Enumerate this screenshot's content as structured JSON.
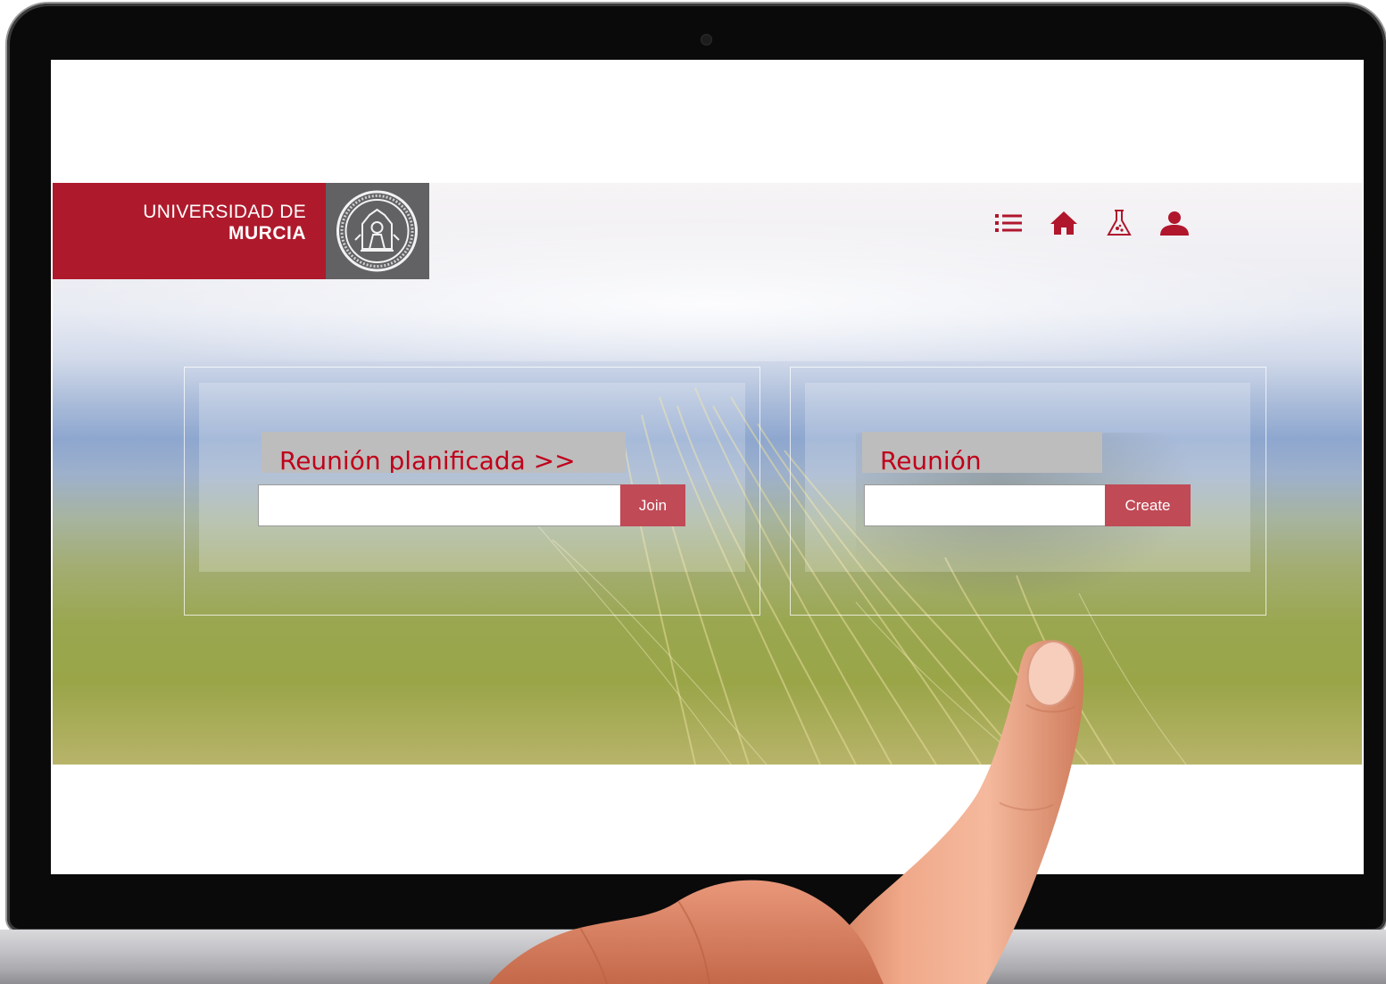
{
  "brand": {
    "name_line1": "UNIVERSIDAD DE",
    "name_line2": "MURCIA",
    "primary_color": "#ae1a2c",
    "seal_bg_color": "#626164"
  },
  "nav": {
    "icons": [
      "list-icon",
      "home-icon",
      "flask-icon",
      "user-icon"
    ],
    "icon_color": "#b0162c"
  },
  "join_card": {
    "title": "Reunión planificada >>",
    "input_value": "",
    "button_label": "Join"
  },
  "create_card": {
    "title": "Reunión",
    "input_value": "",
    "button_label": "Create"
  },
  "colors": {
    "title_text": "#c0001a",
    "title_bg": "#bdbdbd",
    "button_bg": "#c04a56"
  }
}
